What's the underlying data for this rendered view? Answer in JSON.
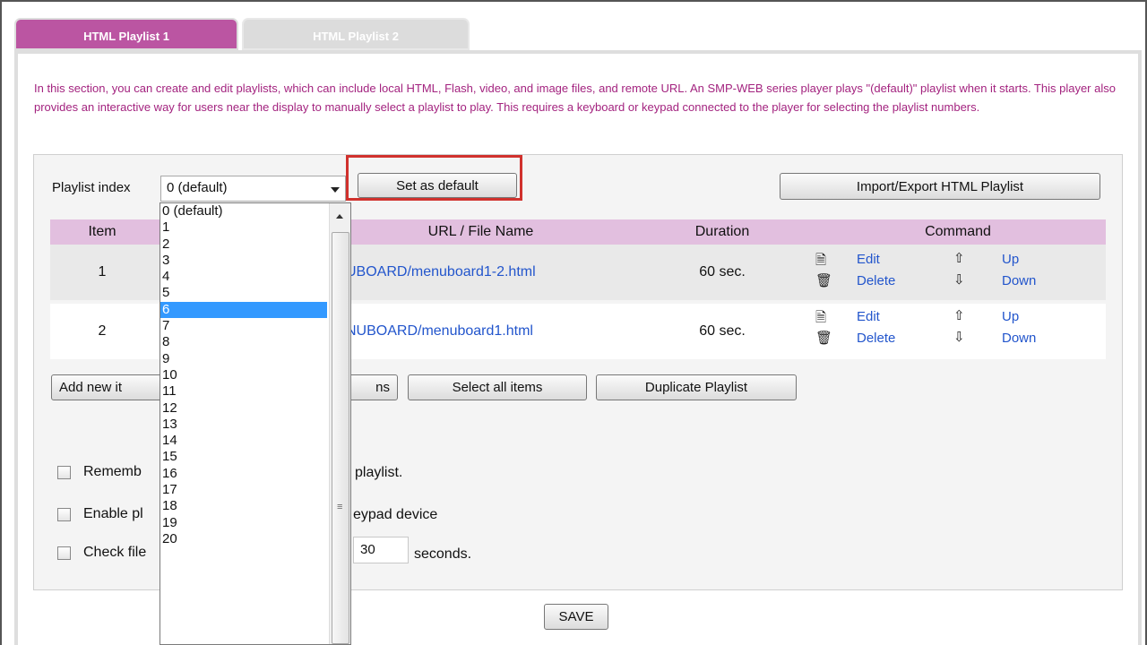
{
  "tabs": [
    {
      "label": "HTML Playlist 1",
      "active": true
    },
    {
      "label": "HTML Playlist 2",
      "active": false
    }
  ],
  "intro_text": "In this section, you can create and edit playlists, which can include local HTML, Flash, video, and image files, and remote URL. An SMP-WEB series player plays \"(default)\" playlist when it starts. This player also provides an interactive way for users near the display to manually select a playlist to play. This requires a keyboard or keypad connected to the player for selecting the playlist numbers.",
  "playlist_index": {
    "label": "Playlist index",
    "selected": "0 (default)",
    "options": [
      "0 (default)",
      "1",
      "2",
      "3",
      "4",
      "5",
      "6",
      "7",
      "8",
      "9",
      "10",
      "11",
      "12",
      "13",
      "14",
      "15",
      "16",
      "17",
      "18",
      "19",
      "20"
    ],
    "highlighted_option": "6"
  },
  "buttons": {
    "set_default": "Set as default",
    "import_export": "Import/Export HTML Playlist",
    "add_new_item": "Add new it",
    "remove_items_fragment": "ns",
    "select_all": "Select all items",
    "duplicate": "Duplicate Playlist",
    "save": "SAVE"
  },
  "table": {
    "headers": {
      "item": "Item",
      "url": "URL / File Name",
      "duration": "Duration",
      "command": "Command"
    },
    "rows": [
      {
        "item": "1",
        "url": "UBOARD/menuboard1-2.html",
        "duration": "60 sec."
      },
      {
        "item": "2",
        "url": "NUBOARD/menuboard1.html",
        "duration": "60 sec."
      }
    ],
    "commands": {
      "edit": "Edit",
      "delete": "Delete",
      "up": "Up",
      "down": "Down"
    }
  },
  "options": {
    "remember_prefix": "Rememb",
    "remember_suffix": "playlist.",
    "enable_prefix": "Enable pl",
    "enable_suffix": "eypad device",
    "check_prefix": "Check file",
    "check_value": "30",
    "check_suffix": "seconds."
  },
  "icons": {
    "edit": "document-icon",
    "delete": "trash-icon",
    "up": "arrow-up-icon",
    "down": "arrow-down-icon"
  },
  "colors": {
    "accent": "#bb55a2",
    "intro_text": "#a3237f",
    "header_row": "#e2bfdf",
    "link": "#2255cc",
    "highlight_box": "#d0312d",
    "selected_option": "#3399ff"
  }
}
